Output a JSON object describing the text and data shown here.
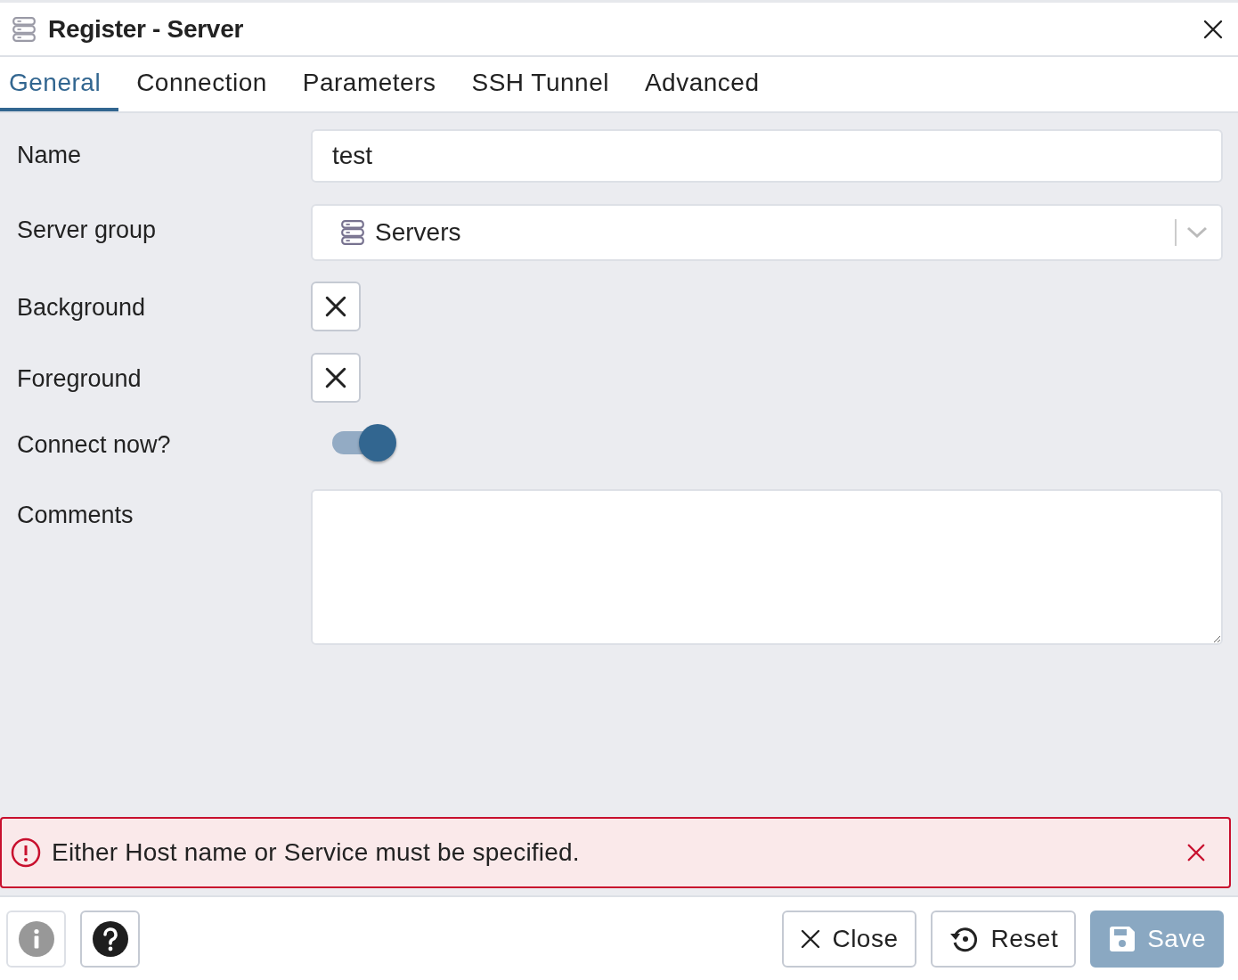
{
  "window": {
    "title": "Register - Server"
  },
  "tabs": [
    {
      "label": "General",
      "selected": true
    },
    {
      "label": "Connection",
      "selected": false
    },
    {
      "label": "Parameters",
      "selected": false
    },
    {
      "label": "SSH Tunnel",
      "selected": false
    },
    {
      "label": "Advanced",
      "selected": false
    }
  ],
  "fields": [
    {
      "kind": "text",
      "label": "Name",
      "value": "test"
    },
    {
      "kind": "select",
      "label": "Server group",
      "value": "Servers"
    },
    {
      "kind": "color",
      "label": "Background"
    },
    {
      "kind": "color",
      "label": "Foreground"
    },
    {
      "kind": "switch",
      "label": "Connect now?",
      "on": true
    },
    {
      "kind": "textarea",
      "label": "Comments"
    }
  ],
  "error": {
    "message": "Either Host name or Service must be specified."
  },
  "footer": {
    "left_buttons": [
      {
        "kind": "info",
        "disabled": true
      },
      {
        "kind": "help",
        "disabled": false
      }
    ],
    "right_buttons": [
      {
        "kind": "close",
        "label": "Close",
        "disabled": false
      },
      {
        "kind": "reset",
        "label": "Reset",
        "disabled": false
      },
      {
        "kind": "save",
        "label": "Save",
        "disabled": true
      }
    ]
  }
}
